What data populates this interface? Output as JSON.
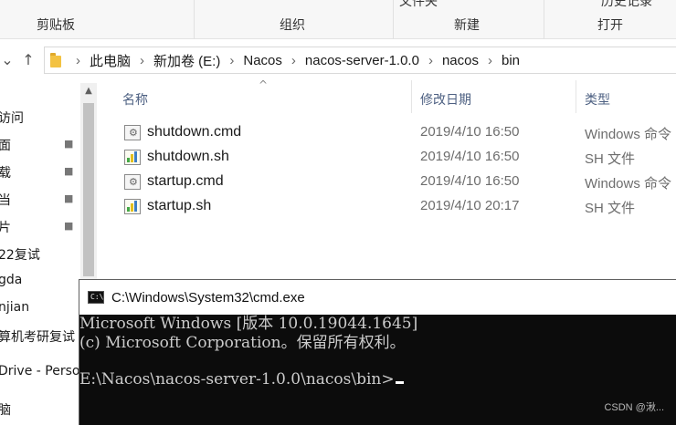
{
  "ribbon": {
    "groups": [
      "剪贴板",
      "组织",
      "新建",
      "打开"
    ],
    "cut_top_left": "文件夹",
    "cut_top_right": "历史记录"
  },
  "nav_buttons": {
    "down": "⌄",
    "up": "↑"
  },
  "address": {
    "crumbs": [
      "此电脑",
      "新加卷 (E:)",
      "Nacos",
      "nacos-server-1.0.0",
      "nacos",
      "bin"
    ],
    "separator": "›"
  },
  "nav_pane": {
    "items": [
      {
        "label": "访问",
        "pinned": false
      },
      {
        "label": "面",
        "pinned": true
      },
      {
        "label": "载",
        "pinned": true
      },
      {
        "label": "当",
        "pinned": true
      },
      {
        "label": "片",
        "pinned": true
      },
      {
        "label": "22复试",
        "pinned": false
      },
      {
        "label": "gda",
        "pinned": false
      },
      {
        "label": "njian",
        "pinned": false
      },
      {
        "label": "算机考研复试",
        "pinned": false
      },
      {
        "label": "Drive - Perso",
        "pinned": false
      },
      {
        "label": "脑",
        "pinned": false
      }
    ],
    "pin_glyph": "📌"
  },
  "file_list": {
    "columns": [
      "名称",
      "修改日期",
      "类型"
    ],
    "sort_indicator": "^",
    "files": [
      {
        "name": "shutdown.cmd",
        "date": "2019/4/10 16:50",
        "type": "Windows 命令",
        "icon": "cmd-file-icon"
      },
      {
        "name": "shutdown.sh",
        "date": "2019/4/10 16:50",
        "type": "SH 文件",
        "icon": "sh-file-icon"
      },
      {
        "name": "startup.cmd",
        "date": "2019/4/10 16:50",
        "type": "Windows 命令",
        "icon": "cmd-file-icon"
      },
      {
        "name": "startup.sh",
        "date": "2019/4/10 20:17",
        "type": "SH 文件",
        "icon": "sh-file-icon"
      }
    ]
  },
  "cmd_window": {
    "title": "C:\\Windows\\System32\\cmd.exe",
    "lines": [
      "Microsoft Windows [版本 10.0.19044.1645]",
      "(c) Microsoft Corporation。保留所有权利。",
      "",
      "E:\\Nacos\\nacos-server-1.0.0\\nacos\\bin>"
    ],
    "watermark": "CSDN @湫..."
  }
}
